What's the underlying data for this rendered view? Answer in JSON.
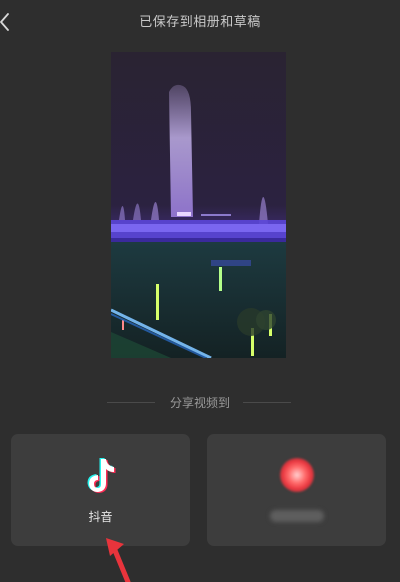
{
  "header": {
    "title": "已保存到相册和草稿",
    "back_icon": "chevron-left-icon"
  },
  "share": {
    "label": "分享视频到",
    "targets": [
      {
        "label": "抖音",
        "icon": "tiktok-icon"
      },
      {
        "label": "",
        "icon": "blurred-app-icon"
      }
    ]
  },
  "colors": {
    "background": "#2e2e2e",
    "card": "#3d3d3d",
    "arrow": "#e8343c"
  }
}
